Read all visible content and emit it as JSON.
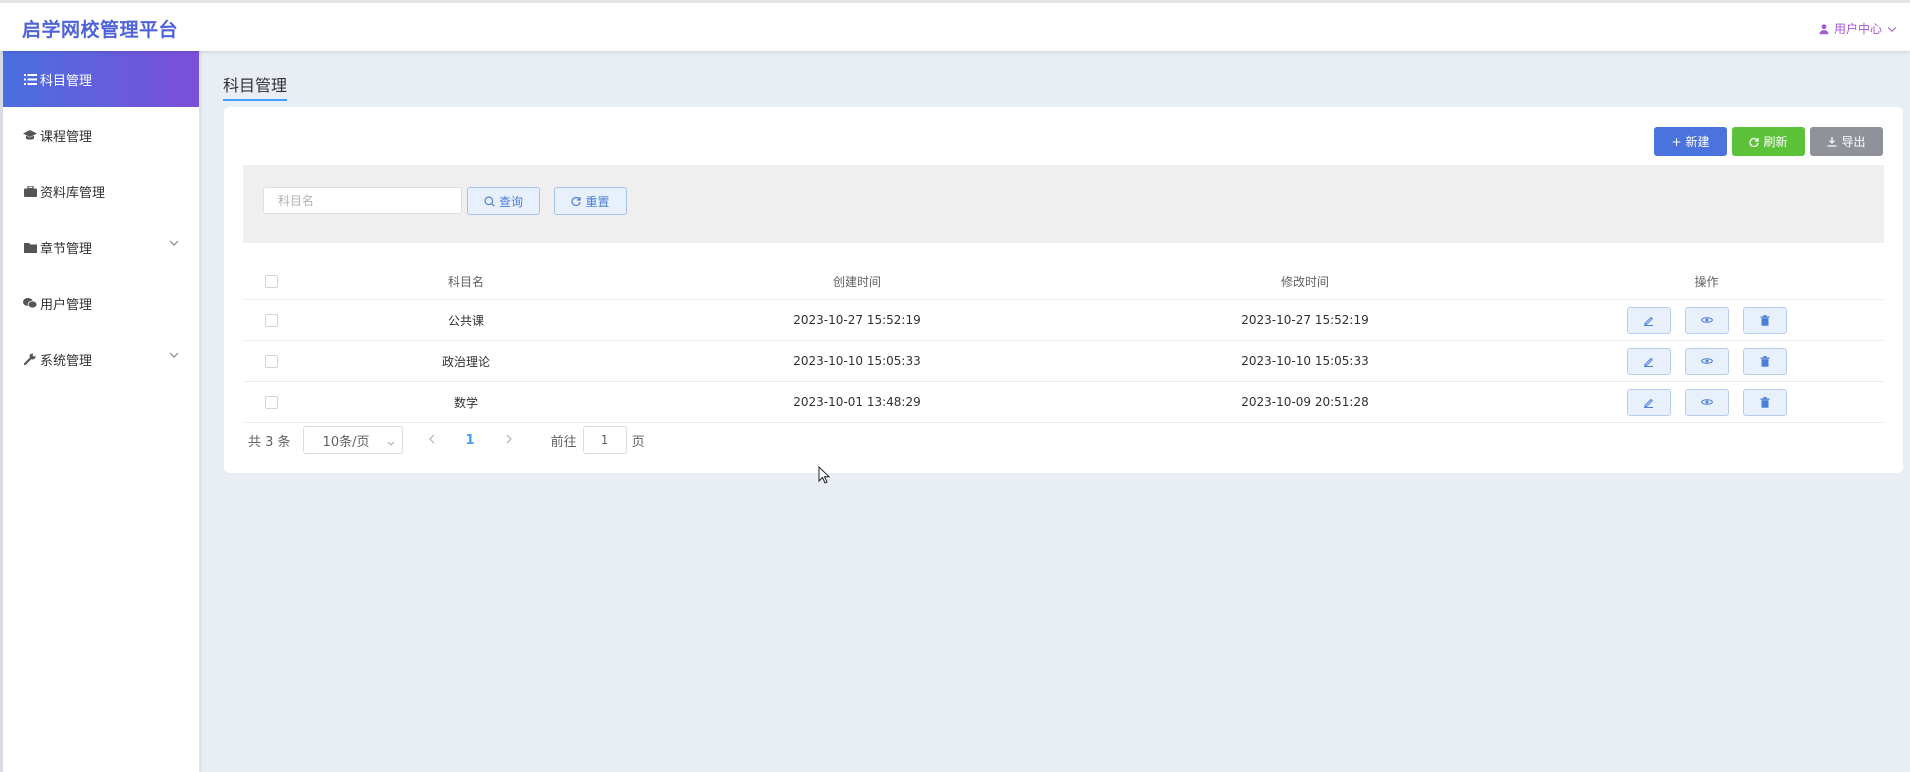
{
  "app": {
    "title": "启学网校管理平台",
    "user_menu": "用户中心"
  },
  "sidebar": {
    "items": [
      {
        "label": "科目管理",
        "icon": "list-icon",
        "active": true,
        "expandable": false
      },
      {
        "label": "课程管理",
        "icon": "graduation-cap-icon",
        "active": false,
        "expandable": false
      },
      {
        "label": "资料库管理",
        "icon": "briefcase-icon",
        "active": false,
        "expandable": false
      },
      {
        "label": "章节管理",
        "icon": "folder-icon",
        "active": false,
        "expandable": true
      },
      {
        "label": "用户管理",
        "icon": "wechat-icon",
        "active": false,
        "expandable": false
      },
      {
        "label": "系统管理",
        "icon": "wrench-icon",
        "active": false,
        "expandable": true
      }
    ]
  },
  "page": {
    "title": "科目管理"
  },
  "toolbar": {
    "new_label": "新建",
    "refresh_label": "刷新",
    "export_label": "导出"
  },
  "search": {
    "placeholder": "科目名",
    "query_label": "查询",
    "reset_label": "重置"
  },
  "table": {
    "headers": {
      "name": "科目名",
      "created": "创建时间",
      "modified": "修改时间",
      "ops": "操作"
    },
    "rows": [
      {
        "name": "公共课",
        "created": "2023-10-27 15:52:19",
        "modified": "2023-10-27 15:52:19"
      },
      {
        "name": "政治理论",
        "created": "2023-10-10 15:05:33",
        "modified": "2023-10-10 15:05:33"
      },
      {
        "name": "数学",
        "created": "2023-10-01 13:48:29",
        "modified": "2023-10-09 20:51:28"
      }
    ]
  },
  "pagination": {
    "total_text": "共 3 条",
    "page_size": "10条/页",
    "current_page": "1",
    "goto_label": "前往",
    "goto_value": "1",
    "page_unit": "页"
  },
  "colors": {
    "brand": "#4f63d8",
    "sidebar_active_start": "#4a6fe0",
    "sidebar_active_end": "#7c4fd8",
    "new": "#4b73de",
    "refresh": "#5bc23a",
    "export": "#8f9298"
  }
}
